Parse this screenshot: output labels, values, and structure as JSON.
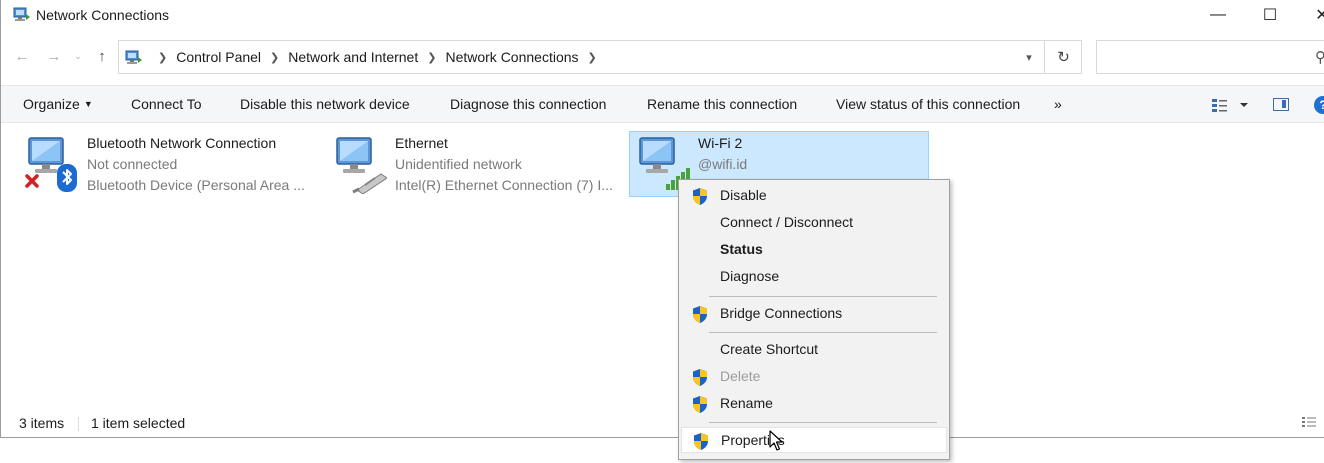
{
  "window": {
    "title": "Network Connections",
    "icon": "network-connections-icon",
    "controls": {
      "minimize": "—",
      "maximize": "☐",
      "close": "✕"
    }
  },
  "navigation": {
    "back": "←",
    "forward": "→",
    "recent": "⌄",
    "up": "↑",
    "breadcrumbs": [
      "Control Panel",
      "Network and Internet",
      "Network Connections"
    ],
    "refresh": "↻",
    "search_placeholder": ""
  },
  "commandbar": {
    "organize": "Organize",
    "connect_to": "Connect To",
    "disable_device": "Disable this network device",
    "diagnose": "Diagnose this connection",
    "rename": "Rename this connection",
    "view_status": "View status of this connection",
    "more": "»",
    "help": "?"
  },
  "connections": [
    {
      "name": "Bluetooth Network Connection",
      "status": "Not connected",
      "device": "Bluetooth Device (Personal Area ...",
      "icon": "bluetooth-network-icon",
      "selected": false
    },
    {
      "name": "Ethernet",
      "status": "Unidentified network",
      "device": "Intel(R) Ethernet Connection (7) I...",
      "icon": "ethernet-network-icon",
      "selected": false
    },
    {
      "name": "Wi-Fi 2",
      "status": "@wifi.id",
      "device": "",
      "icon": "wifi-network-icon",
      "selected": true
    }
  ],
  "statusbar": {
    "item_count": "3 items",
    "selection": "1 item selected"
  },
  "context_menu": {
    "items": [
      {
        "label": "Disable",
        "shield": true,
        "bold": false,
        "disabled": false
      },
      {
        "label": "Connect / Disconnect",
        "shield": false,
        "bold": false,
        "disabled": false
      },
      {
        "label": "Status",
        "shield": false,
        "bold": true,
        "disabled": false
      },
      {
        "label": "Diagnose",
        "shield": false,
        "bold": false,
        "disabled": false
      },
      {
        "label": "Bridge Connections",
        "shield": true,
        "bold": false,
        "disabled": false
      },
      {
        "label": "Create Shortcut",
        "shield": false,
        "bold": false,
        "disabled": false
      },
      {
        "label": "Delete",
        "shield": true,
        "bold": false,
        "disabled": true
      },
      {
        "label": "Rename",
        "shield": true,
        "bold": false,
        "disabled": false
      },
      {
        "label": "Properties",
        "shield": true,
        "bold": false,
        "disabled": false,
        "hovered": true
      }
    ]
  },
  "colors": {
    "selection_bg": "#cce8ff",
    "selection_border": "#99d1ff",
    "menu_bg": "#f2f2f2",
    "shield_blue": "#1c62c6",
    "shield_yellow": "#f7c51d",
    "help_blue": "#1e70d4"
  }
}
